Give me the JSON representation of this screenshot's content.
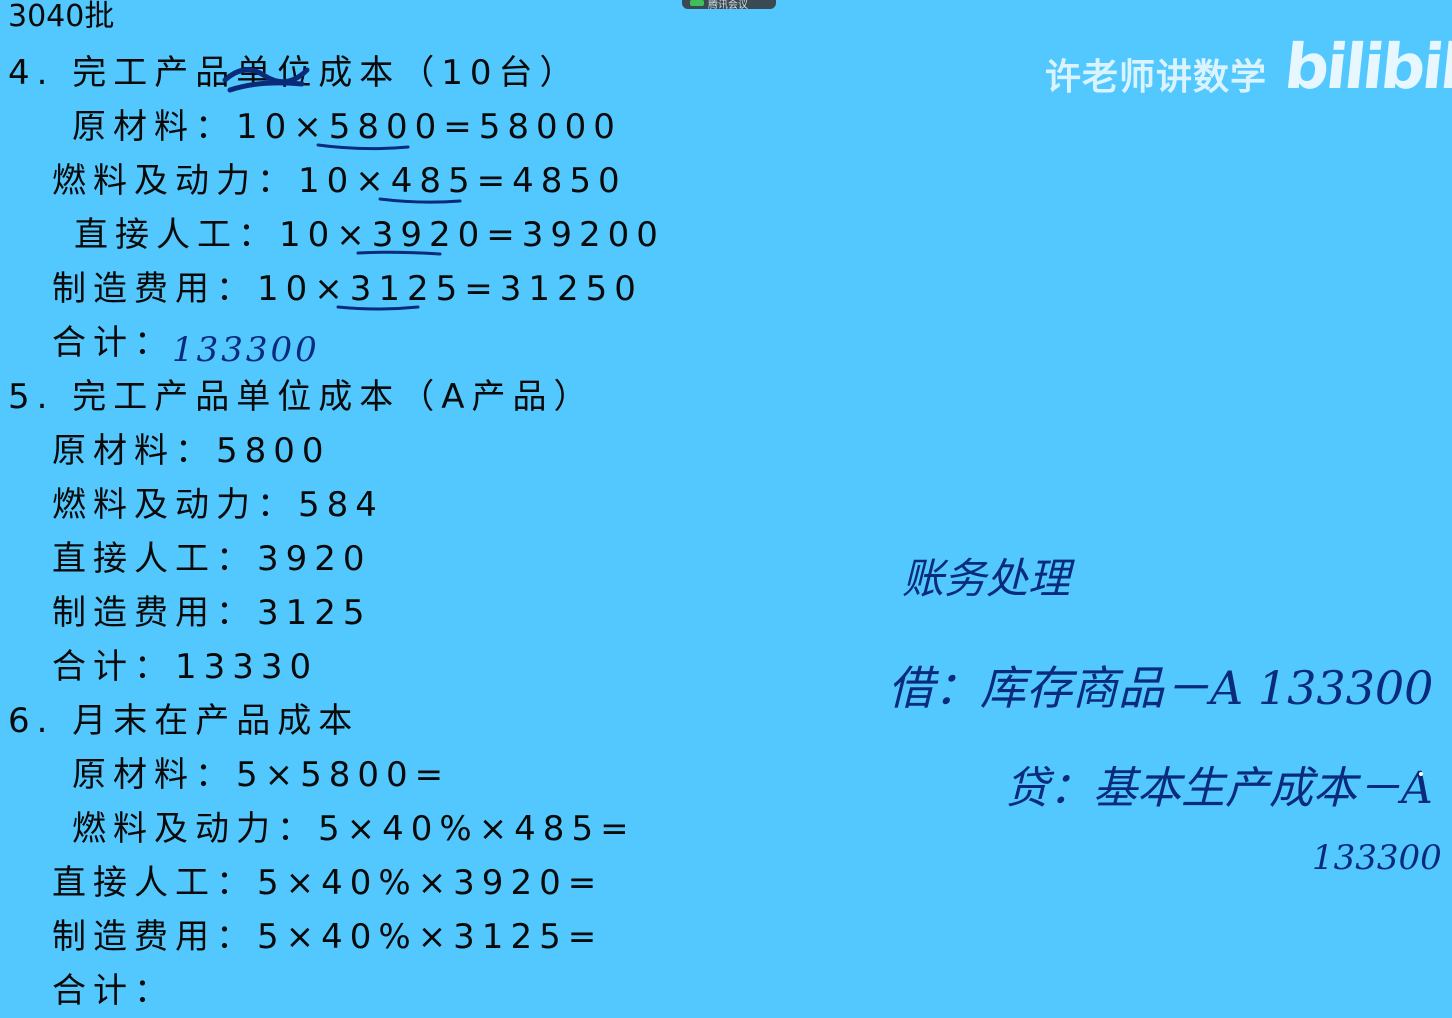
{
  "meeting_bar": {
    "label": "腾讯会议"
  },
  "watermark": {
    "text": "许老师讲数学",
    "logo": "bilibili"
  },
  "lines": [
    {
      "id": "l0",
      "text": "3040批"
    },
    {
      "id": "l1",
      "text": "4. 完工产品单位成本（10台）"
    },
    {
      "id": "l2",
      "text": "原材料：10×5800=58000"
    },
    {
      "id": "l3",
      "text": "燃料及动力：10×485=4850"
    },
    {
      "id": "l4",
      "text": "直接人工：10×3920=39200"
    },
    {
      "id": "l5",
      "text": "制造费用：10×3125=31250"
    },
    {
      "id": "l6",
      "text": "合计："
    },
    {
      "id": "l7",
      "text": "5. 完工产品单位成本（A产品）"
    },
    {
      "id": "l8",
      "text": "原材料：5800"
    },
    {
      "id": "l9",
      "text": "燃料及动力：584"
    },
    {
      "id": "l10",
      "text": "直接人工：3920"
    },
    {
      "id": "l11",
      "text": "制造费用：3125"
    },
    {
      "id": "l12",
      "text": "合计：13330"
    },
    {
      "id": "l13",
      "text": "6. 月末在产品成本"
    },
    {
      "id": "l14",
      "text": "原材料：5×5800="
    },
    {
      "id": "l15",
      "text": "燃料及动力：5×40%×485="
    },
    {
      "id": "l16",
      "text": "直接人工：5×40%×3920="
    },
    {
      "id": "l17",
      "text": "制造费用：5×40%×3125="
    },
    {
      "id": "l18",
      "text": "合计："
    }
  ],
  "handwriting": {
    "total_4": "133300",
    "title": "账务处理",
    "debit": "借：库存商品－A 133300",
    "credit": "贷：基本生产成本－A",
    "credit_amount": "133300"
  }
}
